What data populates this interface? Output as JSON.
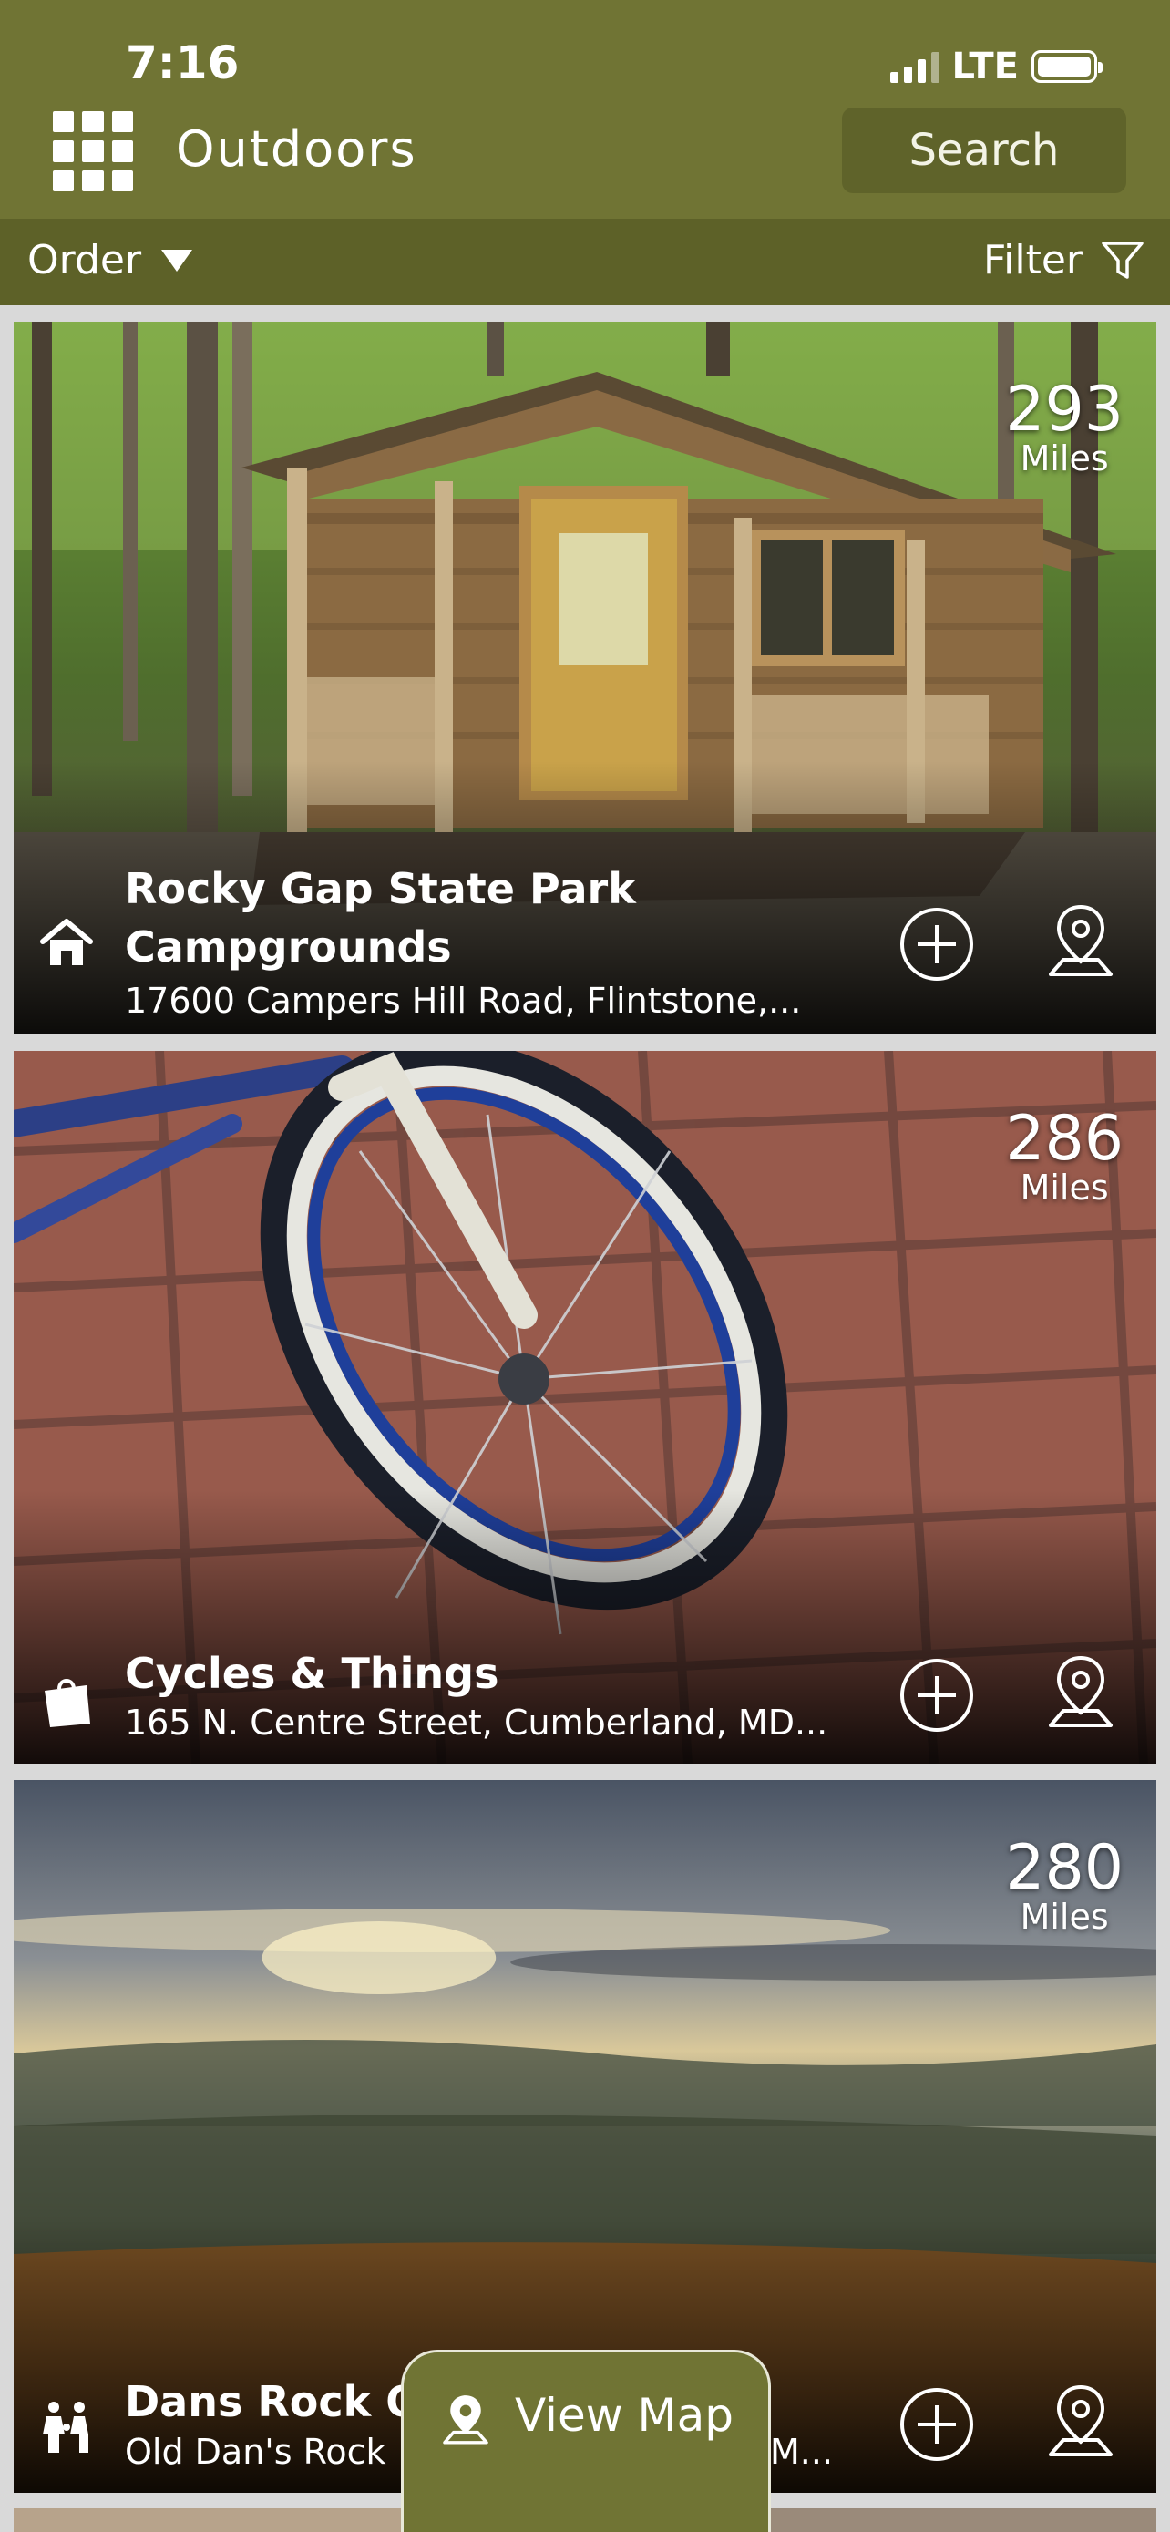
{
  "status": {
    "time": "7:16",
    "network": "LTE"
  },
  "header": {
    "title": "Outdoors",
    "search_label": "Search"
  },
  "toolbar": {
    "order_label": "Order",
    "filter_label": "Filter"
  },
  "listings": [
    {
      "title": "Rocky Gap State Park Campgrounds",
      "address": "17600 Campers Hill Road, Flintstone,...",
      "distance": "293",
      "unit": "Miles",
      "category_icon": "home-icon"
    },
    {
      "title": "Cycles & Things",
      "address": "165 N. Centre Street, Cumberland, MD...",
      "distance": "286",
      "unit": "Miles",
      "category_icon": "shopping-bag-icon"
    },
    {
      "title": "Dans Rock Ov",
      "address": "Old Dan's Rock",
      "address_tail": "M...",
      "distance": "280",
      "unit": "Miles",
      "category_icon": "family-icon"
    }
  ],
  "view_map_label": "View Map",
  "colors": {
    "header": "#707434",
    "subbar": "#5d6128",
    "accent_text": "#ffffff"
  }
}
